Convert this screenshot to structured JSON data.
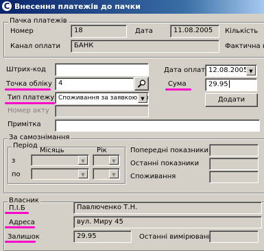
{
  "window": {
    "title": "Внесення платежів до пачки"
  },
  "batch_group": {
    "title": "Пачка платежів",
    "number_label": "Номер",
    "number_value": "18",
    "date_label": "Дата",
    "date_value": "11.08.2005",
    "count_label": "Кількість",
    "channel_label": "Канал оплати",
    "channel_value": "БАНК",
    "actual_label": "Фактична кіл"
  },
  "form": {
    "barcode_label": "Штрих-код",
    "barcode_value": "",
    "point_label": "Точка обліку",
    "point_value": "4",
    "payment_type_label": "Тип платежу",
    "payment_type_value": "Споживання за заявкою або",
    "act_label": "Номер акту",
    "act_value": "",
    "note_label": "Примітка",
    "note_value": "",
    "pay_date_label": "Дата оплати",
    "pay_date_value": "12.08.2005",
    "sum_label": "Сума",
    "sum_value": "29.95",
    "add_button": "Додати"
  },
  "self_reading": {
    "title": "За самознімання",
    "period_title": "Період",
    "month_header": "Місяць",
    "year_header": "Рік",
    "from_label": "з",
    "to_label": "по",
    "prev_label": "Попередні показники",
    "last_label": "Останні показники",
    "consumption_label": "Споживання"
  },
  "owner": {
    "title": "Власник",
    "name_label": "П.І.Б",
    "name_value": "Павлюченко Т.Н.",
    "address_label": "Адреса",
    "address_value": "вул. Миру 45",
    "balance_label": "Залишок",
    "balance_value": "29.95",
    "last_measure_label": "Останні вимірювання"
  },
  "colors": {
    "highlight": "#ff00cc",
    "titlebar": "#0a246a",
    "face": "#d4d0c8"
  },
  "icons": {
    "app": "app-c-icon",
    "lookup": "magnifier-icon",
    "dropdown": "chevron-down-icon"
  }
}
